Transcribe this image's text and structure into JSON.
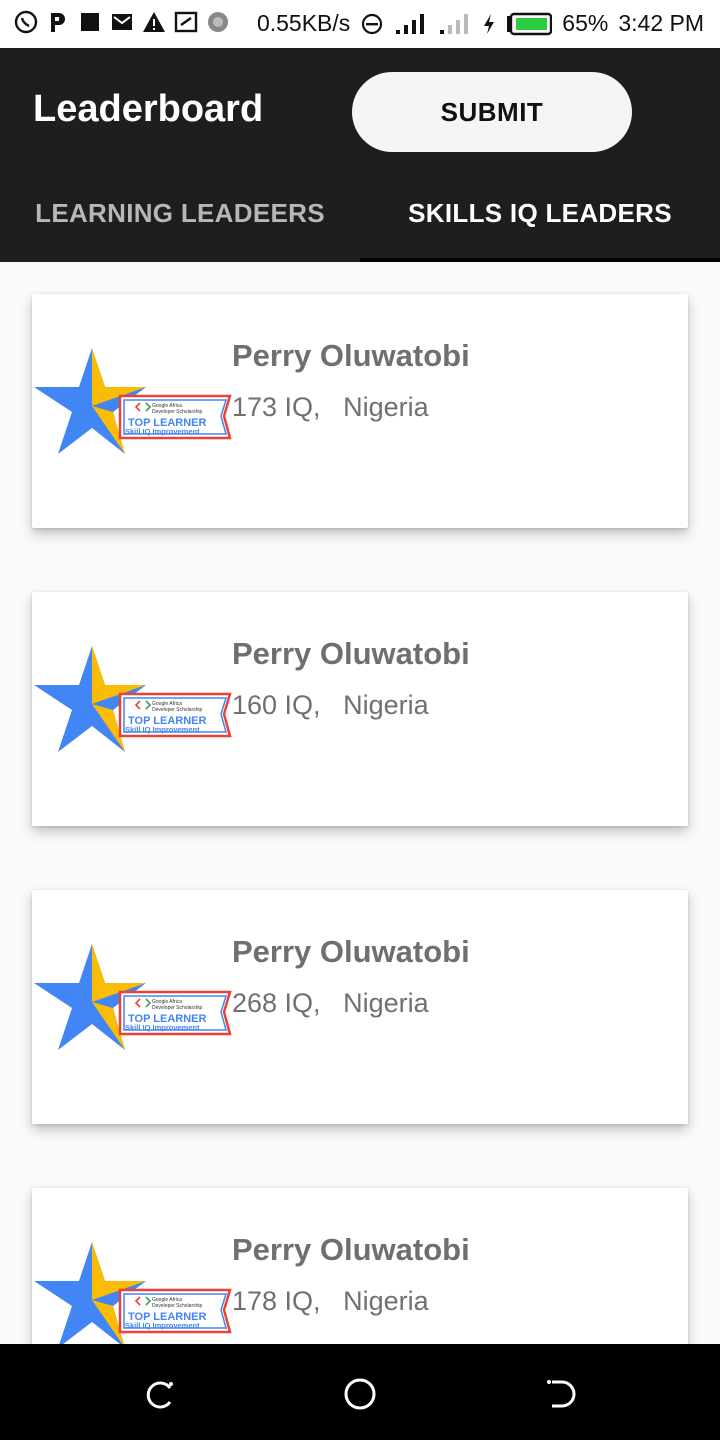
{
  "status_bar": {
    "net_speed": "0.55KB/s",
    "battery": "65%",
    "time": "3:42 PM",
    "icons": [
      "whatsapp-icon",
      "p-app-icon",
      "square-icon",
      "gmail-icon",
      "warning-icon",
      "screenshot-icon",
      "loading-icon",
      "dnd-icon",
      "signal-icon",
      "hplus-signal-icon",
      "charging-icon",
      "battery-icon"
    ]
  },
  "header": {
    "title": "Leaderboard",
    "submit_label": "SUBMIT"
  },
  "tabs": [
    {
      "label": "LEARNING LEADEERS",
      "selected": false
    },
    {
      "label": "SKILLS IQ LEADERS",
      "selected": true
    }
  ],
  "badge": {
    "line1": "Google Africa",
    "line2": "Developer Scholarship",
    "title": "TOP LEARNER",
    "subtitle": "Skill IQ Improvement"
  },
  "leaders": [
    {
      "name": "Perry Oluwatobi",
      "score": "173 IQ,",
      "country": "Nigeria"
    },
    {
      "name": "Perry Oluwatobi",
      "score": "160 IQ,",
      "country": "Nigeria"
    },
    {
      "name": "Perry Oluwatobi",
      "score": "268 IQ,",
      "country": "Nigeria"
    },
    {
      "name": "Perry Oluwatobi",
      "score": "178 IQ,",
      "country": "Nigeria"
    }
  ],
  "colors": {
    "appbar": "#1e1e1e",
    "star_blue": "#4285f4",
    "star_yellow": "#fbbc05",
    "ribbon_red": "#ea4335"
  }
}
